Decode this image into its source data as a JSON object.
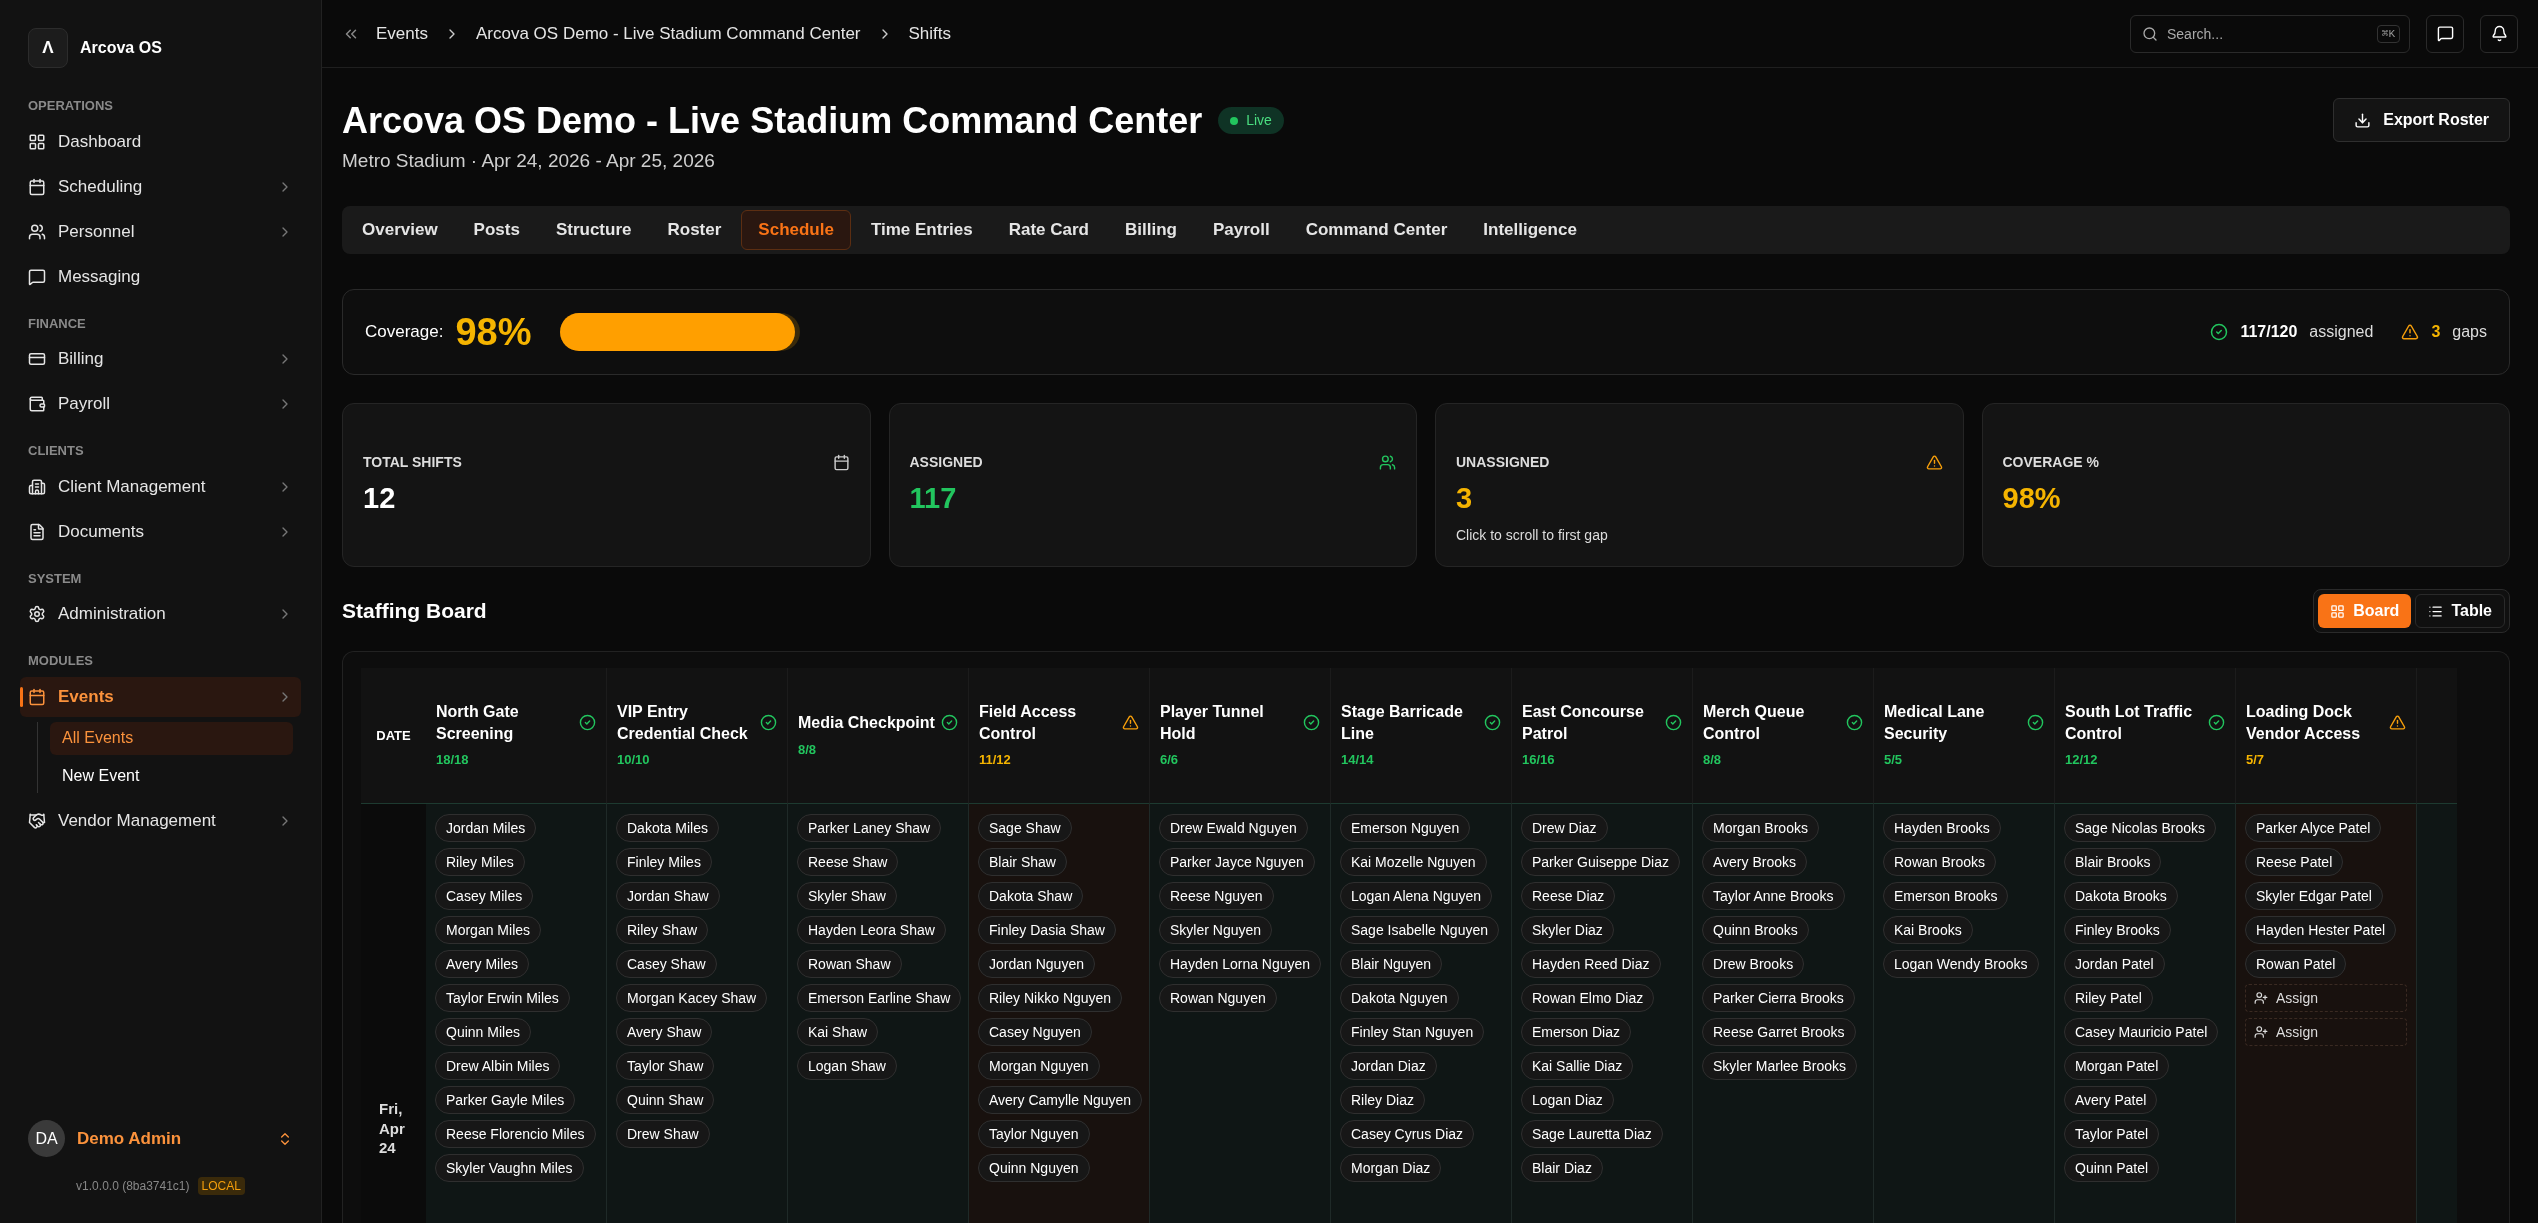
{
  "sidebar": {
    "brand": {
      "logo": "Λ",
      "name": "Arcova OS"
    },
    "sections": [
      {
        "title": "OPERATIONS",
        "items": [
          {
            "label": "Dashboard",
            "chevron": false,
            "selected": false
          },
          {
            "label": "Scheduling",
            "chevron": true,
            "selected": false
          },
          {
            "label": "Personnel",
            "chevron": true,
            "selected": false
          },
          {
            "label": "Messaging",
            "chevron": false,
            "selected": false
          }
        ]
      },
      {
        "title": "FINANCE",
        "items": [
          {
            "label": "Billing",
            "chevron": true,
            "selected": false
          },
          {
            "label": "Payroll",
            "chevron": true,
            "selected": false
          }
        ]
      },
      {
        "title": "CLIENTS",
        "items": [
          {
            "label": "Client Management",
            "chevron": true,
            "selected": false
          },
          {
            "label": "Documents",
            "chevron": true,
            "selected": false
          }
        ]
      },
      {
        "title": "SYSTEM",
        "items": [
          {
            "label": "Administration",
            "chevron": true,
            "selected": false
          }
        ]
      },
      {
        "title": "MODULES",
        "items": [
          {
            "label": "Events",
            "chevron": true,
            "selected": true,
            "children": [
              {
                "label": "All Events",
                "selected": true
              },
              {
                "label": "New Event",
                "selected": false
              }
            ]
          },
          {
            "label": "Vendor Management",
            "chevron": true,
            "selected": false
          }
        ]
      }
    ],
    "user": {
      "initials": "DA",
      "name": "Demo Admin"
    },
    "version": "v1.0.0.0 (8ba3741c1)",
    "env": "LOCAL"
  },
  "topbar": {
    "breadcrumbs": [
      "Events",
      "Arcova OS Demo - Live Stadium Command Center",
      "Shifts"
    ],
    "search": {
      "placeholder": "Search...",
      "shortcut": "⌘K"
    }
  },
  "header": {
    "title": "Arcova OS Demo - Live Stadium Command Center",
    "status": "Live",
    "subtitle": "Metro Stadium · Apr 24, 2026 - Apr 25, 2026",
    "action": "Export Roster"
  },
  "tabs": [
    {
      "label": "Overview",
      "selected": false
    },
    {
      "label": "Posts",
      "selected": false
    },
    {
      "label": "Structure",
      "selected": false
    },
    {
      "label": "Roster",
      "selected": false
    },
    {
      "label": "Schedule",
      "selected": true
    },
    {
      "label": "Time Entries",
      "selected": false
    },
    {
      "label": "Rate Card",
      "selected": false
    },
    {
      "label": "Billing",
      "selected": false
    },
    {
      "label": "Payroll",
      "selected": false
    },
    {
      "label": "Command Center",
      "selected": false
    },
    {
      "label": "Intelligence",
      "selected": false
    }
  ],
  "coverage": {
    "label": "Coverage:",
    "value": "98%",
    "level": 0.98,
    "assigned": "117/120",
    "assigned_label": "assigned",
    "gaps": "3",
    "gaps_label": "gaps"
  },
  "stats": [
    {
      "label": "TOTAL SHIFTS",
      "value": "12",
      "kind": "total"
    },
    {
      "label": "ASSIGNED",
      "value": "117",
      "kind": "assigned"
    },
    {
      "label": "UNASSIGNED",
      "value": "3",
      "kind": "unassigned",
      "note": "Click to scroll to first gap"
    },
    {
      "label": "COVERAGE %",
      "value": "98%",
      "kind": "coverage"
    }
  ],
  "board": {
    "title": "Staffing Board",
    "views": [
      {
        "label": "Board",
        "selected": true
      },
      {
        "label": "Table",
        "selected": false
      }
    ],
    "date_header": "DATE",
    "date": "Fri, Apr 24",
    "posts": [
      {
        "name": "North Gate Screening",
        "count": "18/18",
        "kind": "full",
        "people": [
          "Jordan Miles",
          "Riley Miles",
          "Casey Miles",
          "Morgan Miles",
          "Avery Miles",
          "Taylor Erwin Miles",
          "Quinn Miles",
          "Drew Albin Miles",
          "Parker Gayle Miles",
          "Reese Florencio Miles",
          "Skyler Vaughn Miles"
        ]
      },
      {
        "name": "VIP Entry Credential Check",
        "count": "10/10",
        "kind": "full",
        "people": [
          "Dakota Miles",
          "Finley Miles",
          "Jordan Shaw",
          "Riley Shaw",
          "Casey Shaw",
          "Morgan Kacey Shaw",
          "Avery Shaw",
          "Taylor Shaw",
          "Quinn Shaw",
          "Drew Shaw"
        ]
      },
      {
        "name": "Media Checkpoint",
        "count": "8/8",
        "kind": "full",
        "people": [
          "Parker Laney Shaw",
          "Reese Shaw",
          "Skyler Shaw",
          "Hayden Leora Shaw",
          "Rowan Shaw",
          "Emerson Earline Shaw",
          "Kai Shaw",
          "Logan Shaw"
        ]
      },
      {
        "name": "Field Access Control",
        "count": "11/12",
        "kind": "short",
        "people": [
          "Sage Shaw",
          "Blair Shaw",
          "Dakota Shaw",
          "Finley Dasia Shaw",
          "Jordan Nguyen",
          "Riley Nikko Nguyen",
          "Casey Nguyen",
          "Morgan Nguyen",
          "Avery Camylle Nguyen",
          "Taylor Nguyen",
          "Quinn Nguyen"
        ]
      },
      {
        "name": "Player Tunnel Hold",
        "count": "6/6",
        "kind": "full",
        "people": [
          "Drew Ewald Nguyen",
          "Parker Jayce Nguyen",
          "Reese Nguyen",
          "Skyler Nguyen",
          "Hayden Lorna Nguyen",
          "Rowan Nguyen"
        ]
      },
      {
        "name": "Stage Barricade Line",
        "count": "14/14",
        "kind": "full",
        "people": [
          "Emerson Nguyen",
          "Kai Mozelle Nguyen",
          "Logan Alena Nguyen",
          "Sage Isabelle Nguyen",
          "Blair Nguyen",
          "Dakota Nguyen",
          "Finley Stan Nguyen",
          "Jordan Diaz",
          "Riley Diaz",
          "Casey Cyrus Diaz",
          "Morgan Diaz"
        ]
      },
      {
        "name": "East Concourse Patrol",
        "count": "16/16",
        "kind": "full",
        "people": [
          "Drew Diaz",
          "Parker Guiseppe Diaz",
          "Reese Diaz",
          "Skyler Diaz",
          "Hayden Reed Diaz",
          "Rowan Elmo Diaz",
          "Emerson Diaz",
          "Kai Sallie Diaz",
          "Logan Diaz",
          "Sage Lauretta Diaz",
          "Blair Diaz"
        ]
      },
      {
        "name": "Merch Queue Control",
        "count": "8/8",
        "kind": "full",
        "people": [
          "Morgan Brooks",
          "Avery Brooks",
          "Taylor Anne Brooks",
          "Quinn Brooks",
          "Drew Brooks",
          "Parker Cierra Brooks",
          "Reese Garret Brooks",
          "Skyler Marlee Brooks"
        ]
      },
      {
        "name": "Medical Lane Security",
        "count": "5/5",
        "kind": "full",
        "people": [
          "Hayden Brooks",
          "Rowan Brooks",
          "Emerson Brooks",
          "Kai Brooks",
          "Logan Wendy Brooks"
        ]
      },
      {
        "name": "South Lot Traffic Control",
        "count": "12/12",
        "kind": "full",
        "people": [
          "Sage Nicolas Brooks",
          "Blair Brooks",
          "Dakota Brooks",
          "Finley Brooks",
          "Jordan Patel",
          "Riley Patel",
          "Casey Mauricio Patel",
          "Morgan Patel",
          "Avery Patel",
          "Taylor Patel",
          "Quinn Patel"
        ]
      },
      {
        "name": "Loading Dock Vendor Access",
        "count": "5/7",
        "kind": "short",
        "people": [
          "Parker Alyce Patel",
          "Reese Patel",
          "Skyler Edgar Patel",
          "Hayden Hester Patel",
          "Rowan Patel"
        ],
        "open_slots": [
          "Assign",
          "Assign"
        ]
      }
    ]
  }
}
